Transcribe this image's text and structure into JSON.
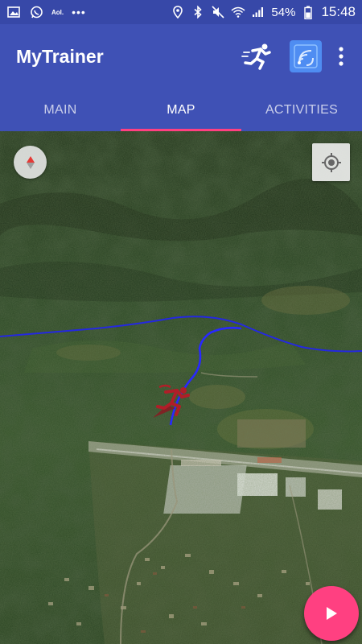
{
  "status_bar": {
    "left_icons": [
      "image-icon",
      "whatsapp-icon",
      "aol-icon",
      "more-notifications-icon"
    ],
    "aol_text": "Aol.",
    "dots_text": "•••",
    "right_icons": [
      "location-icon",
      "bluetooth-icon",
      "mute-icon",
      "wifi-icon",
      "cell-signal-icon",
      "battery-icon"
    ],
    "battery": "54%",
    "time": "15:48"
  },
  "app_bar": {
    "title": "MyTrainer",
    "actions": [
      "runner-icon",
      "activity-tracker-icon",
      "overflow-menu-icon"
    ],
    "color": "#3f51b5"
  },
  "tabs": [
    {
      "label": "MAIN",
      "active": false
    },
    {
      "label": "MAP",
      "active": true
    },
    {
      "label": "ACTIVITIES",
      "active": false
    }
  ],
  "map": {
    "view": "3D satellite terrain",
    "controls": [
      "compass-icon",
      "my-location-icon"
    ],
    "route_color": "#2020ff",
    "marker": "runner-marker-icon"
  },
  "fab": {
    "icon": "play-icon",
    "color": "#ff4081"
  }
}
